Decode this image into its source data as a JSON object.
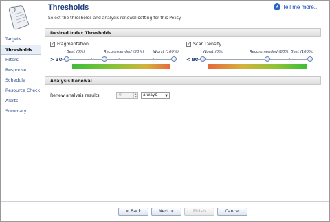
{
  "header": {
    "title": "Thresholds",
    "subtitle": "Select the thresholds and analysis renewal setting for this Policy.",
    "help_icon": "question-circle-icon",
    "help_link": "Tell me more..."
  },
  "sidebar": {
    "items": [
      {
        "label": "Targets",
        "active": false
      },
      {
        "label": "Thresholds",
        "active": true
      },
      {
        "label": "Filters",
        "active": false
      },
      {
        "label": "Response",
        "active": false
      },
      {
        "label": "Schedule",
        "active": false
      },
      {
        "label": "Resource Check",
        "active": false
      },
      {
        "label": "Alerts",
        "active": false
      },
      {
        "label": "Summary",
        "active": false
      }
    ]
  },
  "sections": {
    "thresholds_header": "Desired Index Thresholds",
    "renewal_header": "Analysis Renewal"
  },
  "fragmentation": {
    "label": "Fragmentation",
    "checked": true,
    "check_mark": "✓",
    "value_label": "> 30",
    "value": 30,
    "marks": {
      "best": "Best (0%)",
      "recommended": "Recommended (30%)",
      "worst": "Worst (100%)"
    }
  },
  "scan_density": {
    "label": "Scan Density",
    "checked": true,
    "check_mark": "✓",
    "value_label": "< 80",
    "value": 80,
    "marks": {
      "worst": "Worst (0%)",
      "recommended": "Recommended (80%)",
      "best": "Best (100%)"
    }
  },
  "renewal": {
    "label": "Renew analysis results:",
    "value": "0",
    "option": "always"
  },
  "footer": {
    "back": "< Back",
    "next": "Next >",
    "finish": "Finish",
    "cancel": "Cancel"
  },
  "colors": {
    "title": "#1f3f7a",
    "link": "#1a47b8",
    "gradient_start": "#3dbd3a",
    "gradient_end": "#e76a3c"
  }
}
